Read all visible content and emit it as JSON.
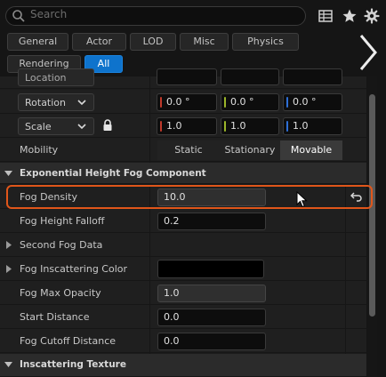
{
  "toolbar": {
    "search_placeholder": "Search",
    "icons": [
      "search-icon",
      "table-view-icon",
      "star-icon",
      "gear-icon"
    ]
  },
  "filter_tabs": [
    {
      "label": "General",
      "active": false
    },
    {
      "label": "Actor",
      "active": false
    },
    {
      "label": "LOD",
      "active": false
    },
    {
      "label": "Misc",
      "active": false
    },
    {
      "label": "Physics",
      "active": false
    },
    {
      "label": "Rendering",
      "active": false
    },
    {
      "label": "All",
      "active": true
    }
  ],
  "transform": {
    "location_label": "Location",
    "rotation": {
      "label": "Rotation",
      "x": "0.0 °",
      "y": "0.0 °",
      "z": "0.0 °"
    },
    "scale": {
      "label": "Scale",
      "x": "1.0",
      "y": "1.0",
      "z": "1.0"
    },
    "mobility": {
      "label": "Mobility",
      "options": [
        "Static",
        "Stationary",
        "Movable"
      ],
      "selected": "Movable"
    }
  },
  "fog_section": {
    "title": "Exponential Height Fog Component",
    "properties": {
      "fog_density": {
        "label": "Fog Density",
        "value": "10.0"
      },
      "fog_height_falloff": {
        "label": "Fog Height Falloff",
        "value": "0.2"
      },
      "second_fog_data": {
        "label": "Second Fog Data"
      },
      "fog_inscattering_color": {
        "label": "Fog Inscattering Color",
        "color": "#000000"
      },
      "fog_max_opacity": {
        "label": "Fog Max Opacity",
        "value": "1.0"
      },
      "start_distance": {
        "label": "Start Distance",
        "value": "0.0"
      },
      "fog_cutoff_distance": {
        "label": "Fog Cutoff Distance",
        "value": "0.0"
      }
    }
  },
  "inscattering_section": {
    "title": "Inscattering Texture"
  },
  "colors": {
    "accent": "#0e73cc",
    "highlight": "#e0561a",
    "axis_x": "#c0392b",
    "axis_y": "#9bb52a",
    "axis_z": "#2e6fd6"
  }
}
